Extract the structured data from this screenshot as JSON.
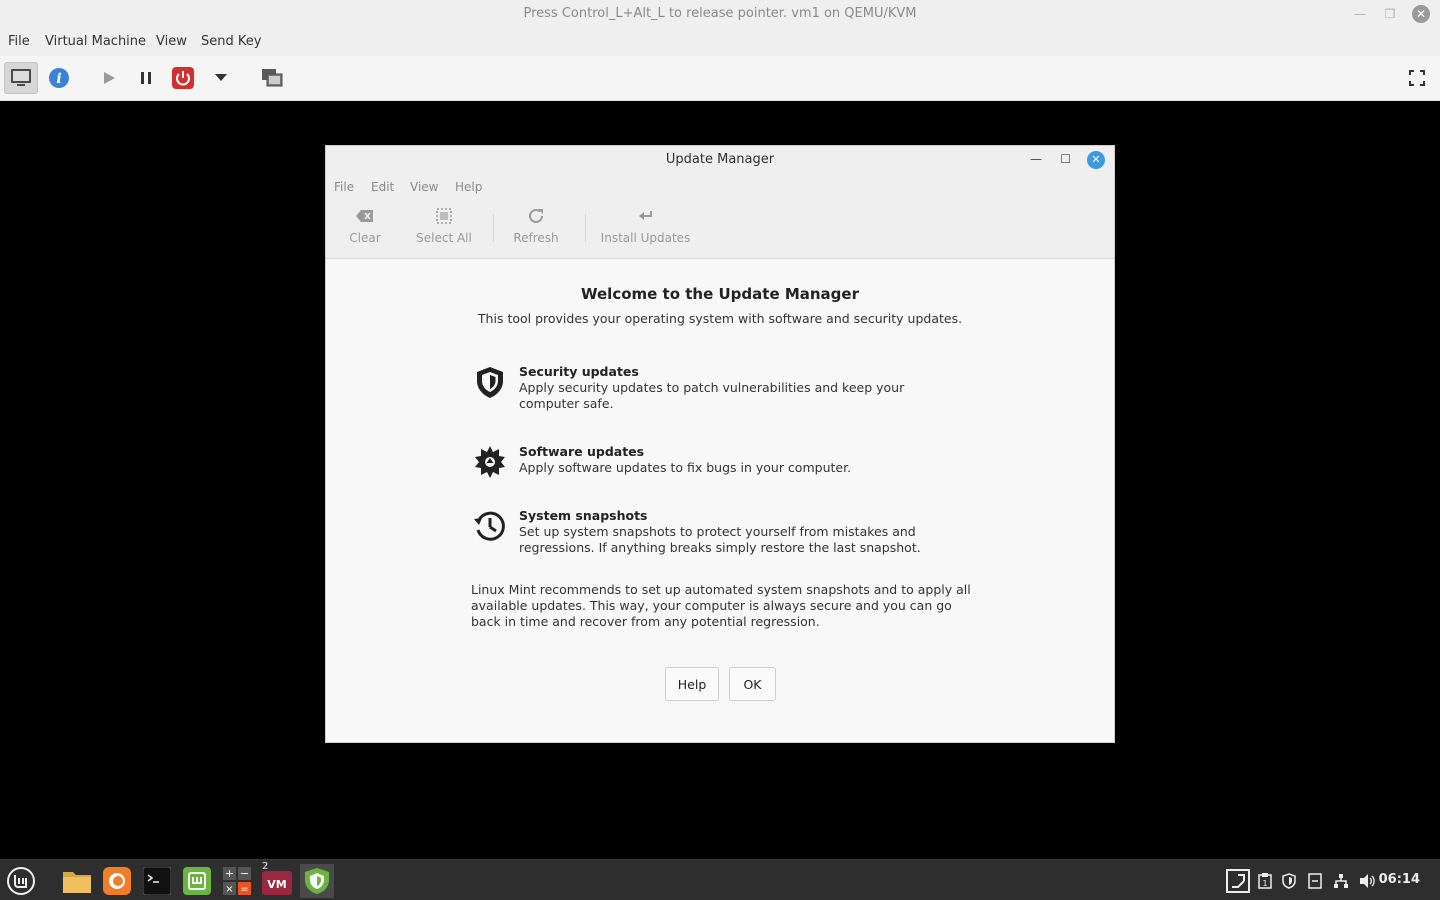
{
  "host": {
    "title": "Press Control_L+Alt_L to release pointer. vm1 on QEMU/KVM",
    "menu": [
      "File",
      "Virtual Machine",
      "View",
      "Send Key"
    ],
    "toolbar_icons": [
      "monitor-icon",
      "info-icon",
      "play-icon",
      "pause-icon",
      "power-icon",
      "dropdown-icon",
      "snapshots-icon",
      "fullscreen-icon"
    ]
  },
  "dialog": {
    "title": "Update Manager",
    "menu": [
      "File",
      "Edit",
      "View",
      "Help"
    ],
    "toolbar": {
      "clear": "Clear",
      "select_all": "Select All",
      "refresh": "Refresh",
      "install": "Install Updates"
    },
    "welcome_title": "Welcome to the Update Manager",
    "welcome_sub": "This tool provides your operating system with software and security updates.",
    "features": [
      {
        "title": "Security updates",
        "desc": "Apply security updates to patch vulnerabilities and keep your computer safe.",
        "icon": "shield-icon"
      },
      {
        "title": "Software updates",
        "desc": "Apply software updates to fix bugs in your computer.",
        "icon": "gear-icon"
      },
      {
        "title": "System snapshots",
        "desc": "Set up system snapshots to protect yourself from mistakes and regressions. If anything breaks simply restore the last snapshot.",
        "icon": "history-icon"
      }
    ],
    "recommendation": "Linux Mint recommends to set up automated system snapshots and to apply all available updates. This way, your computer is always secure and you can go back in time and recover from any potential regression.",
    "help_button": "Help",
    "ok_button": "OK"
  },
  "taskbar": {
    "clock": "06:14",
    "vm_badge": "2",
    "accent": "#3d9ae0"
  }
}
